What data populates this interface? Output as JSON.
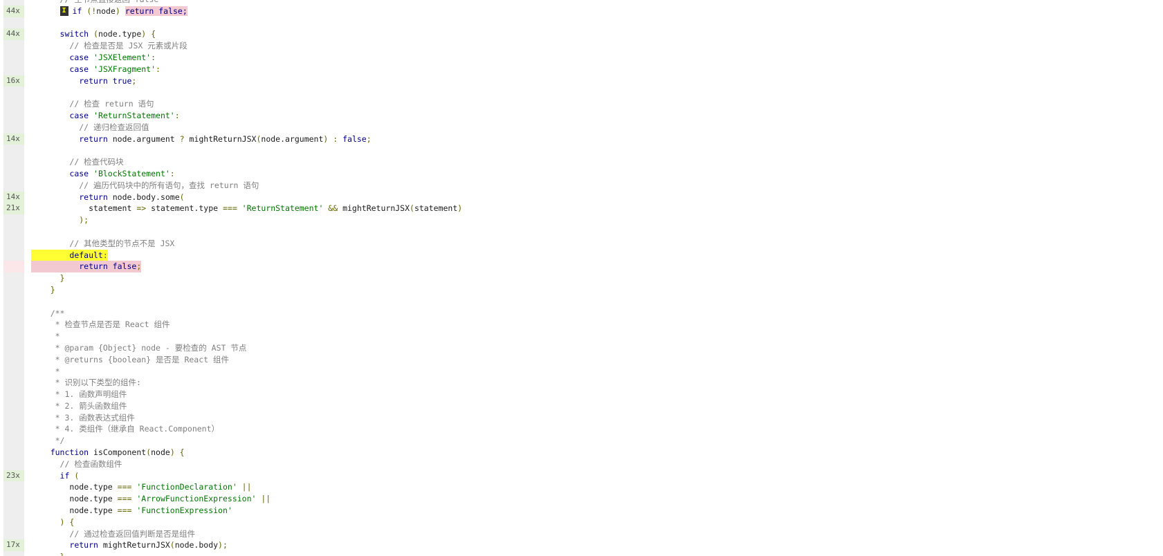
{
  "coverage_view": {
    "lines": [
      {
        "count": "",
        "tokens": [
          {
            "t": "// 空节点直接返回 false",
            "c": "cm"
          }
        ]
      },
      {
        "count": "44x",
        "state": "covered",
        "marker": "I",
        "tokens": [
          {
            "t": "if",
            "c": "kw"
          },
          {
            "t": " (",
            "c": "pun"
          },
          {
            "t": "!",
            "c": "pun"
          },
          {
            "t": "node",
            "c": "fn"
          },
          {
            "t": ") ",
            "c": "pun"
          },
          {
            "t": "return false;",
            "c": "kw",
            "pink": true
          }
        ]
      },
      {
        "count": "",
        "tokens": []
      },
      {
        "count": "44x",
        "state": "covered",
        "tokens": [
          {
            "t": "switch",
            "c": "kw"
          },
          {
            "t": " (",
            "c": "pun"
          },
          {
            "t": "node.type",
            "c": "fn"
          },
          {
            "t": ") {",
            "c": "pun"
          }
        ]
      },
      {
        "count": "",
        "tokens": [
          {
            "t": "  // 检查是否是 JSX 元素或片段",
            "c": "cm"
          }
        ]
      },
      {
        "count": "",
        "tokens": [
          {
            "t": "  case ",
            "c": "kw"
          },
          {
            "t": "'JSXElement'",
            "c": "str"
          },
          {
            "t": ":",
            "c": "pun"
          }
        ]
      },
      {
        "count": "",
        "tokens": [
          {
            "t": "  case ",
            "c": "kw"
          },
          {
            "t": "'JSXFragment'",
            "c": "str"
          },
          {
            "t": ":",
            "c": "pun"
          }
        ]
      },
      {
        "count": "16x",
        "state": "covered",
        "tokens": [
          {
            "t": "    return true",
            "c": "kw"
          },
          {
            "t": ";",
            "c": "pun"
          }
        ]
      },
      {
        "count": "",
        "tokens": []
      },
      {
        "count": "",
        "tokens": [
          {
            "t": "  // 检查 return 语句",
            "c": "cm"
          }
        ]
      },
      {
        "count": "",
        "tokens": [
          {
            "t": "  case ",
            "c": "kw"
          },
          {
            "t": "'ReturnStatement'",
            "c": "str"
          },
          {
            "t": ":",
            "c": "pun"
          }
        ]
      },
      {
        "count": "",
        "tokens": [
          {
            "t": "    // 递归检查返回值",
            "c": "cm"
          }
        ]
      },
      {
        "count": "14x",
        "state": "covered",
        "tokens": [
          {
            "t": "    return ",
            "c": "kw"
          },
          {
            "t": "node.argument ",
            "c": "fn"
          },
          {
            "t": "? ",
            "c": "pun"
          },
          {
            "t": "mightReturnJSX",
            "c": "fn"
          },
          {
            "t": "(",
            "c": "pun"
          },
          {
            "t": "node.argument",
            "c": "fn"
          },
          {
            "t": ") : ",
            "c": "pun"
          },
          {
            "t": "false",
            "c": "kw"
          },
          {
            "t": ";",
            "c": "pun"
          }
        ]
      },
      {
        "count": "",
        "tokens": []
      },
      {
        "count": "",
        "tokens": [
          {
            "t": "  // 检查代码块",
            "c": "cm"
          }
        ]
      },
      {
        "count": "",
        "tokens": [
          {
            "t": "  case ",
            "c": "kw"
          },
          {
            "t": "'BlockStatement'",
            "c": "str"
          },
          {
            "t": ":",
            "c": "pun"
          }
        ]
      },
      {
        "count": "",
        "tokens": [
          {
            "t": "    // 遍历代码块中的所有语句，查找 return 语句",
            "c": "cm"
          }
        ]
      },
      {
        "count": "14x",
        "state": "covered",
        "tokens": [
          {
            "t": "    return ",
            "c": "kw"
          },
          {
            "t": "node.body.some",
            "c": "fn"
          },
          {
            "t": "(",
            "c": "pun"
          }
        ]
      },
      {
        "count": "21x",
        "state": "covered",
        "tokens": [
          {
            "t": "      statement ",
            "c": "fn"
          },
          {
            "t": "=> ",
            "c": "pun"
          },
          {
            "t": "statement.type ",
            "c": "fn"
          },
          {
            "t": "=== ",
            "c": "pun"
          },
          {
            "t": "'ReturnStatement' ",
            "c": "str"
          },
          {
            "t": "&& ",
            "c": "pun"
          },
          {
            "t": "mightReturnJSX",
            "c": "fn"
          },
          {
            "t": "(",
            "c": "pun"
          },
          {
            "t": "statement",
            "c": "fn"
          },
          {
            "t": ")",
            "c": "pun"
          }
        ]
      },
      {
        "count": "",
        "tokens": [
          {
            "t": "    );",
            "c": "pun"
          }
        ]
      },
      {
        "count": "",
        "tokens": []
      },
      {
        "count": "",
        "tokens": [
          {
            "t": "  // 其他类型的节点不是 JSX",
            "c": "cm"
          }
        ]
      },
      {
        "count": "",
        "hl": "yellow",
        "tokens": [
          {
            "t": "  default",
            "c": "kw"
          },
          {
            "t": ":",
            "c": "pun"
          }
        ]
      },
      {
        "count": "",
        "state": "uncovered",
        "hl": "pink",
        "tokens": [
          {
            "t": "    return false",
            "c": "kw"
          },
          {
            "t": ";",
            "c": "pun"
          }
        ]
      },
      {
        "count": "",
        "tokens": [
          {
            "t": "}",
            "c": "pun"
          }
        ]
      },
      {
        "count": "",
        "tokens": [
          {
            "t": "}",
            "c": "pun"
          }
        ],
        "indent": -1
      },
      {
        "count": "",
        "tokens": []
      },
      {
        "count": "",
        "indent": -1,
        "tokens": [
          {
            "t": "/**",
            "c": "cm"
          }
        ]
      },
      {
        "count": "",
        "indent": -1,
        "tokens": [
          {
            "t": " * 检查节点是否是 React 组件",
            "c": "cm"
          }
        ]
      },
      {
        "count": "",
        "indent": -1,
        "tokens": [
          {
            "t": " *",
            "c": "cm"
          }
        ]
      },
      {
        "count": "",
        "indent": -1,
        "tokens": [
          {
            "t": " * @param {Object} node - 要检查的 AST 节点",
            "c": "cm"
          }
        ]
      },
      {
        "count": "",
        "indent": -1,
        "tokens": [
          {
            "t": " * @returns {boolean} 是否是 React 组件",
            "c": "cm"
          }
        ]
      },
      {
        "count": "",
        "indent": -1,
        "tokens": [
          {
            "t": " *",
            "c": "cm"
          }
        ]
      },
      {
        "count": "",
        "indent": -1,
        "tokens": [
          {
            "t": " * 识别以下类型的组件:",
            "c": "cm"
          }
        ]
      },
      {
        "count": "",
        "indent": -1,
        "tokens": [
          {
            "t": " * 1. 函数声明组件",
            "c": "cm"
          }
        ]
      },
      {
        "count": "",
        "indent": -1,
        "tokens": [
          {
            "t": " * 2. 箭头函数组件",
            "c": "cm"
          }
        ]
      },
      {
        "count": "",
        "indent": -1,
        "tokens": [
          {
            "t": " * 3. 函数表达式组件",
            "c": "cm"
          }
        ]
      },
      {
        "count": "",
        "indent": -1,
        "tokens": [
          {
            "t": " * 4. 类组件（继承自 React.Component）",
            "c": "cm"
          }
        ]
      },
      {
        "count": "",
        "indent": -1,
        "tokens": [
          {
            "t": " */",
            "c": "cm"
          }
        ]
      },
      {
        "count": "",
        "indent": -1,
        "tokens": [
          {
            "t": "function ",
            "c": "kw"
          },
          {
            "t": "isComponent",
            "c": "fn"
          },
          {
            "t": "(",
            "c": "pun"
          },
          {
            "t": "node",
            "c": "fn"
          },
          {
            "t": ") {",
            "c": "pun"
          }
        ]
      },
      {
        "count": "",
        "tokens": [
          {
            "t": "// 检查函数组件",
            "c": "cm"
          }
        ]
      },
      {
        "count": "23x",
        "state": "covered",
        "tokens": [
          {
            "t": "if ",
            "c": "kw"
          },
          {
            "t": "(",
            "c": "pun"
          }
        ]
      },
      {
        "count": "",
        "tokens": [
          {
            "t": "  node.type ",
            "c": "fn"
          },
          {
            "t": "=== ",
            "c": "pun"
          },
          {
            "t": "'FunctionDeclaration' ",
            "c": "str"
          },
          {
            "t": "||",
            "c": "pun"
          }
        ]
      },
      {
        "count": "",
        "tokens": [
          {
            "t": "  node.type ",
            "c": "fn"
          },
          {
            "t": "=== ",
            "c": "pun"
          },
          {
            "t": "'ArrowFunctionExpression' ",
            "c": "str"
          },
          {
            "t": "||",
            "c": "pun"
          }
        ]
      },
      {
        "count": "",
        "tokens": [
          {
            "t": "  node.type ",
            "c": "fn"
          },
          {
            "t": "=== ",
            "c": "pun"
          },
          {
            "t": "'FunctionExpression'",
            "c": "str"
          }
        ]
      },
      {
        "count": "",
        "tokens": [
          {
            "t": ") {",
            "c": "pun"
          }
        ]
      },
      {
        "count": "",
        "tokens": [
          {
            "t": "  // 通过检查返回值判断是否是组件",
            "c": "cm"
          }
        ]
      },
      {
        "count": "17x",
        "state": "covered",
        "tokens": [
          {
            "t": "  return ",
            "c": "kw"
          },
          {
            "t": "mightReturnJSX",
            "c": "fn"
          },
          {
            "t": "(",
            "c": "pun"
          },
          {
            "t": "node.body",
            "c": "fn"
          },
          {
            "t": ");",
            "c": "pun"
          }
        ]
      },
      {
        "count": "",
        "tokens": [
          {
            "t": "}",
            "c": "pun"
          }
        ]
      }
    ]
  }
}
